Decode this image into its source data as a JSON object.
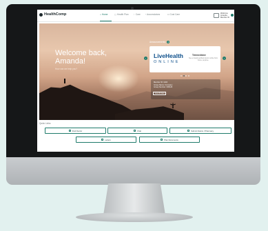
{
  "header": {
    "logo": "HealthComp",
    "nav": [
      {
        "label": "Home",
        "icon": "home-icon",
        "active": true
      },
      {
        "label": "Health Plan",
        "icon": "plan-icon",
        "active": false
      },
      {
        "label": "Care",
        "icon": "care-icon",
        "active": false
      },
      {
        "label": "Accumulators",
        "icon": "chart-icon",
        "active": false
      },
      {
        "label": "Cost Care",
        "icon": "cost-icon",
        "active": false
      }
    ],
    "user_line1": "Welcome Amanda",
    "user_line2": "Member ID"
  },
  "hero": {
    "welcome": "Welcome back, Amanda!",
    "subtitle": "How can we help you?"
  },
  "announcement": {
    "label": "Announcements",
    "count": "4",
    "brand_top": "LiveHealth",
    "brand_bottom": "ONLINE",
    "heading": "Telemedicine",
    "text": "See a board-certified doctor online from home, anytime.",
    "dots": 4,
    "active_dot": 1
  },
  "info": {
    "line1": "Member ID: 1234",
    "line2": "Group Name: Company",
    "line3": "Group Number: 000123",
    "button": "View ID Card"
  },
  "quick_links": {
    "label": "Quick Links",
    "items": [
      "Find Doctor",
      "Chat",
      "Submit Claims / Pharmacy",
      "Letters",
      "Plan Documents"
    ]
  },
  "colors": {
    "accent": "#1d7a6a",
    "background": "#e2f1ef"
  }
}
